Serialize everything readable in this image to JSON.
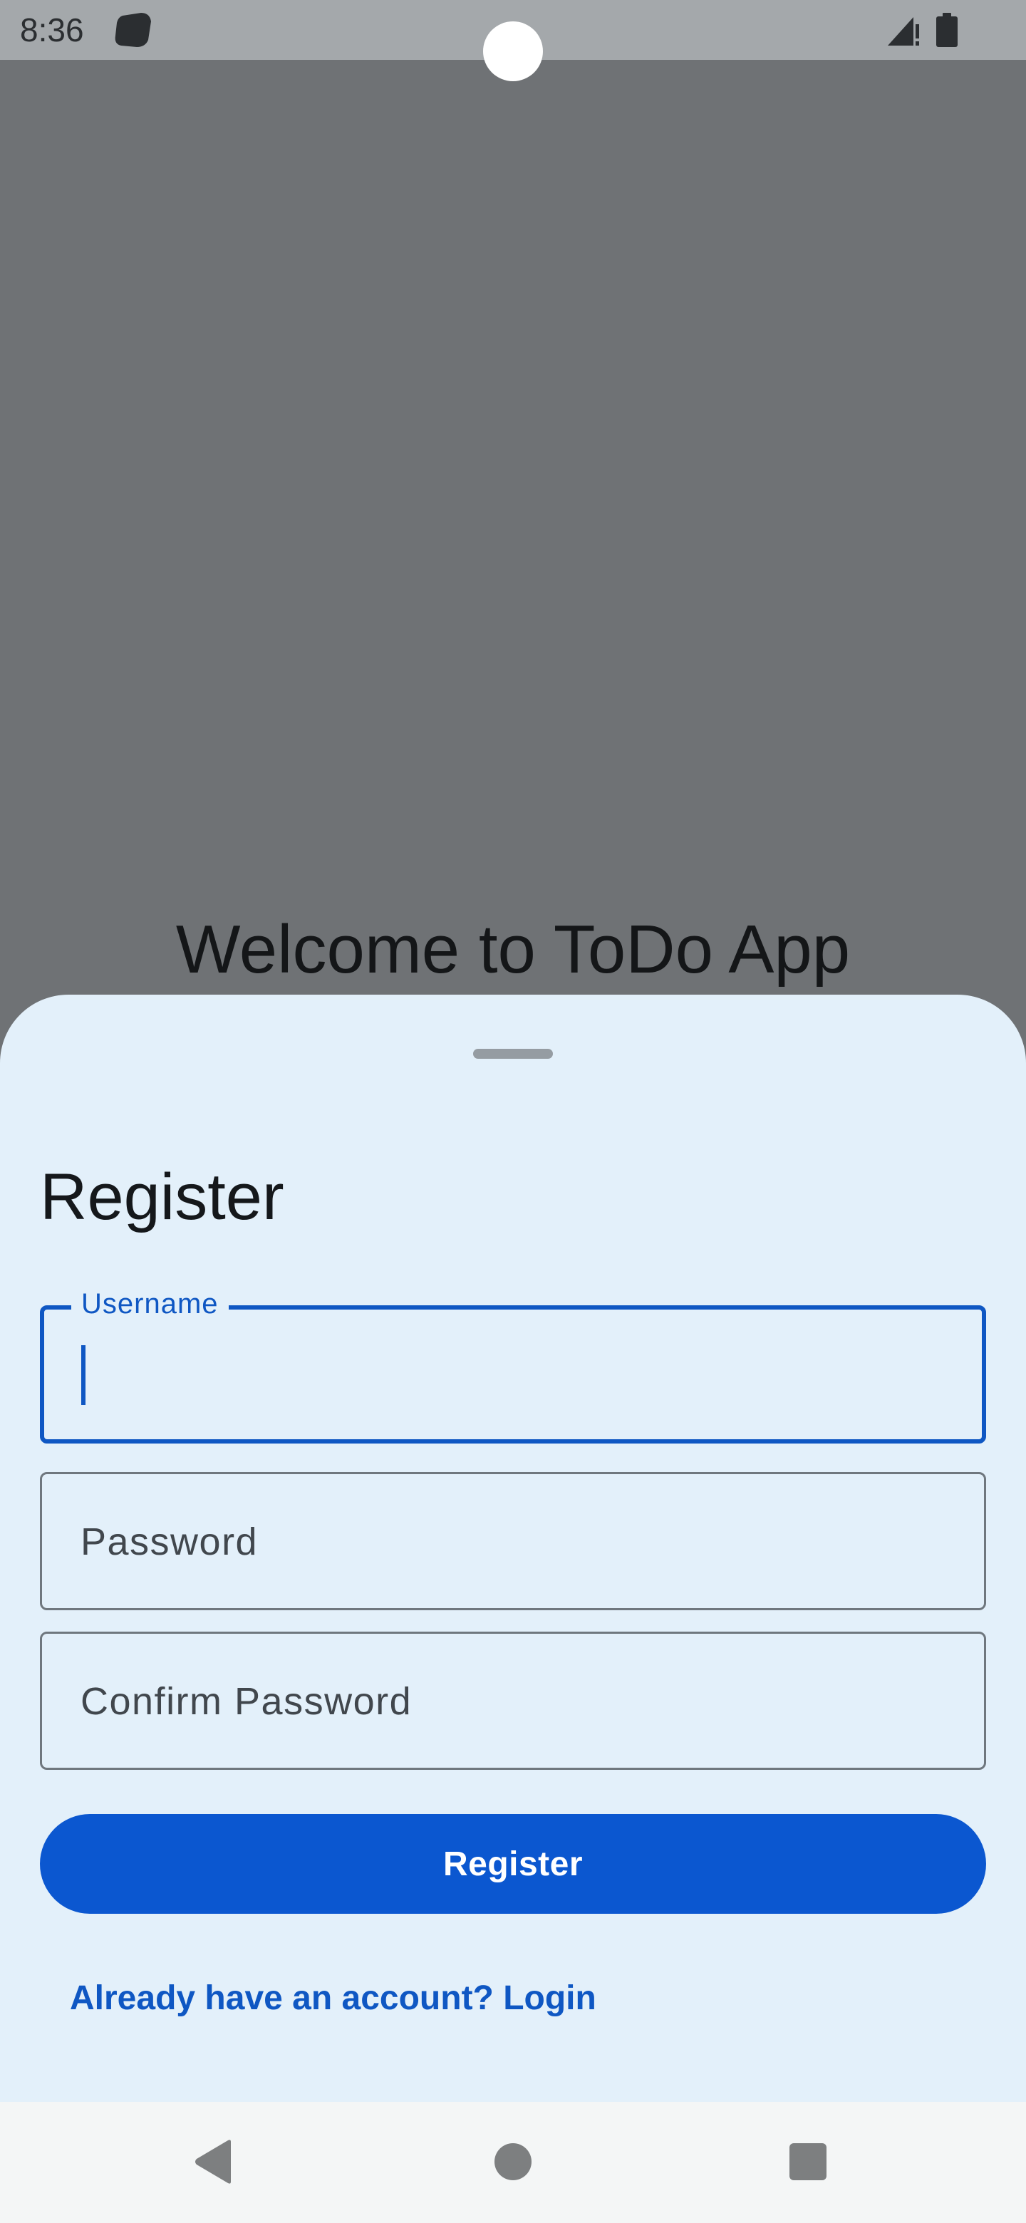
{
  "status_bar": {
    "time": "8:36",
    "icons": [
      "app-notification-icon",
      "signal-icon",
      "battery-icon"
    ]
  },
  "welcome": {
    "title": "Welcome to ToDo App"
  },
  "register_sheet": {
    "title": "Register",
    "username": {
      "label": "Username",
      "value": "",
      "focused": true
    },
    "password": {
      "placeholder": "Password",
      "value": ""
    },
    "confirm_password": {
      "placeholder": "Confirm Password",
      "value": ""
    },
    "register_button": "Register",
    "login_link": "Already have an account? Login"
  },
  "navigation_bar": {
    "buttons": [
      "back-icon",
      "home-icon",
      "recents-icon"
    ]
  },
  "colors": {
    "primary": "#0b57d0",
    "sheet_background": "#e3f0fa",
    "scrim": "#6f7275",
    "status_bar": "#a4a8ab",
    "nav_bar": "#f4f6f6"
  }
}
